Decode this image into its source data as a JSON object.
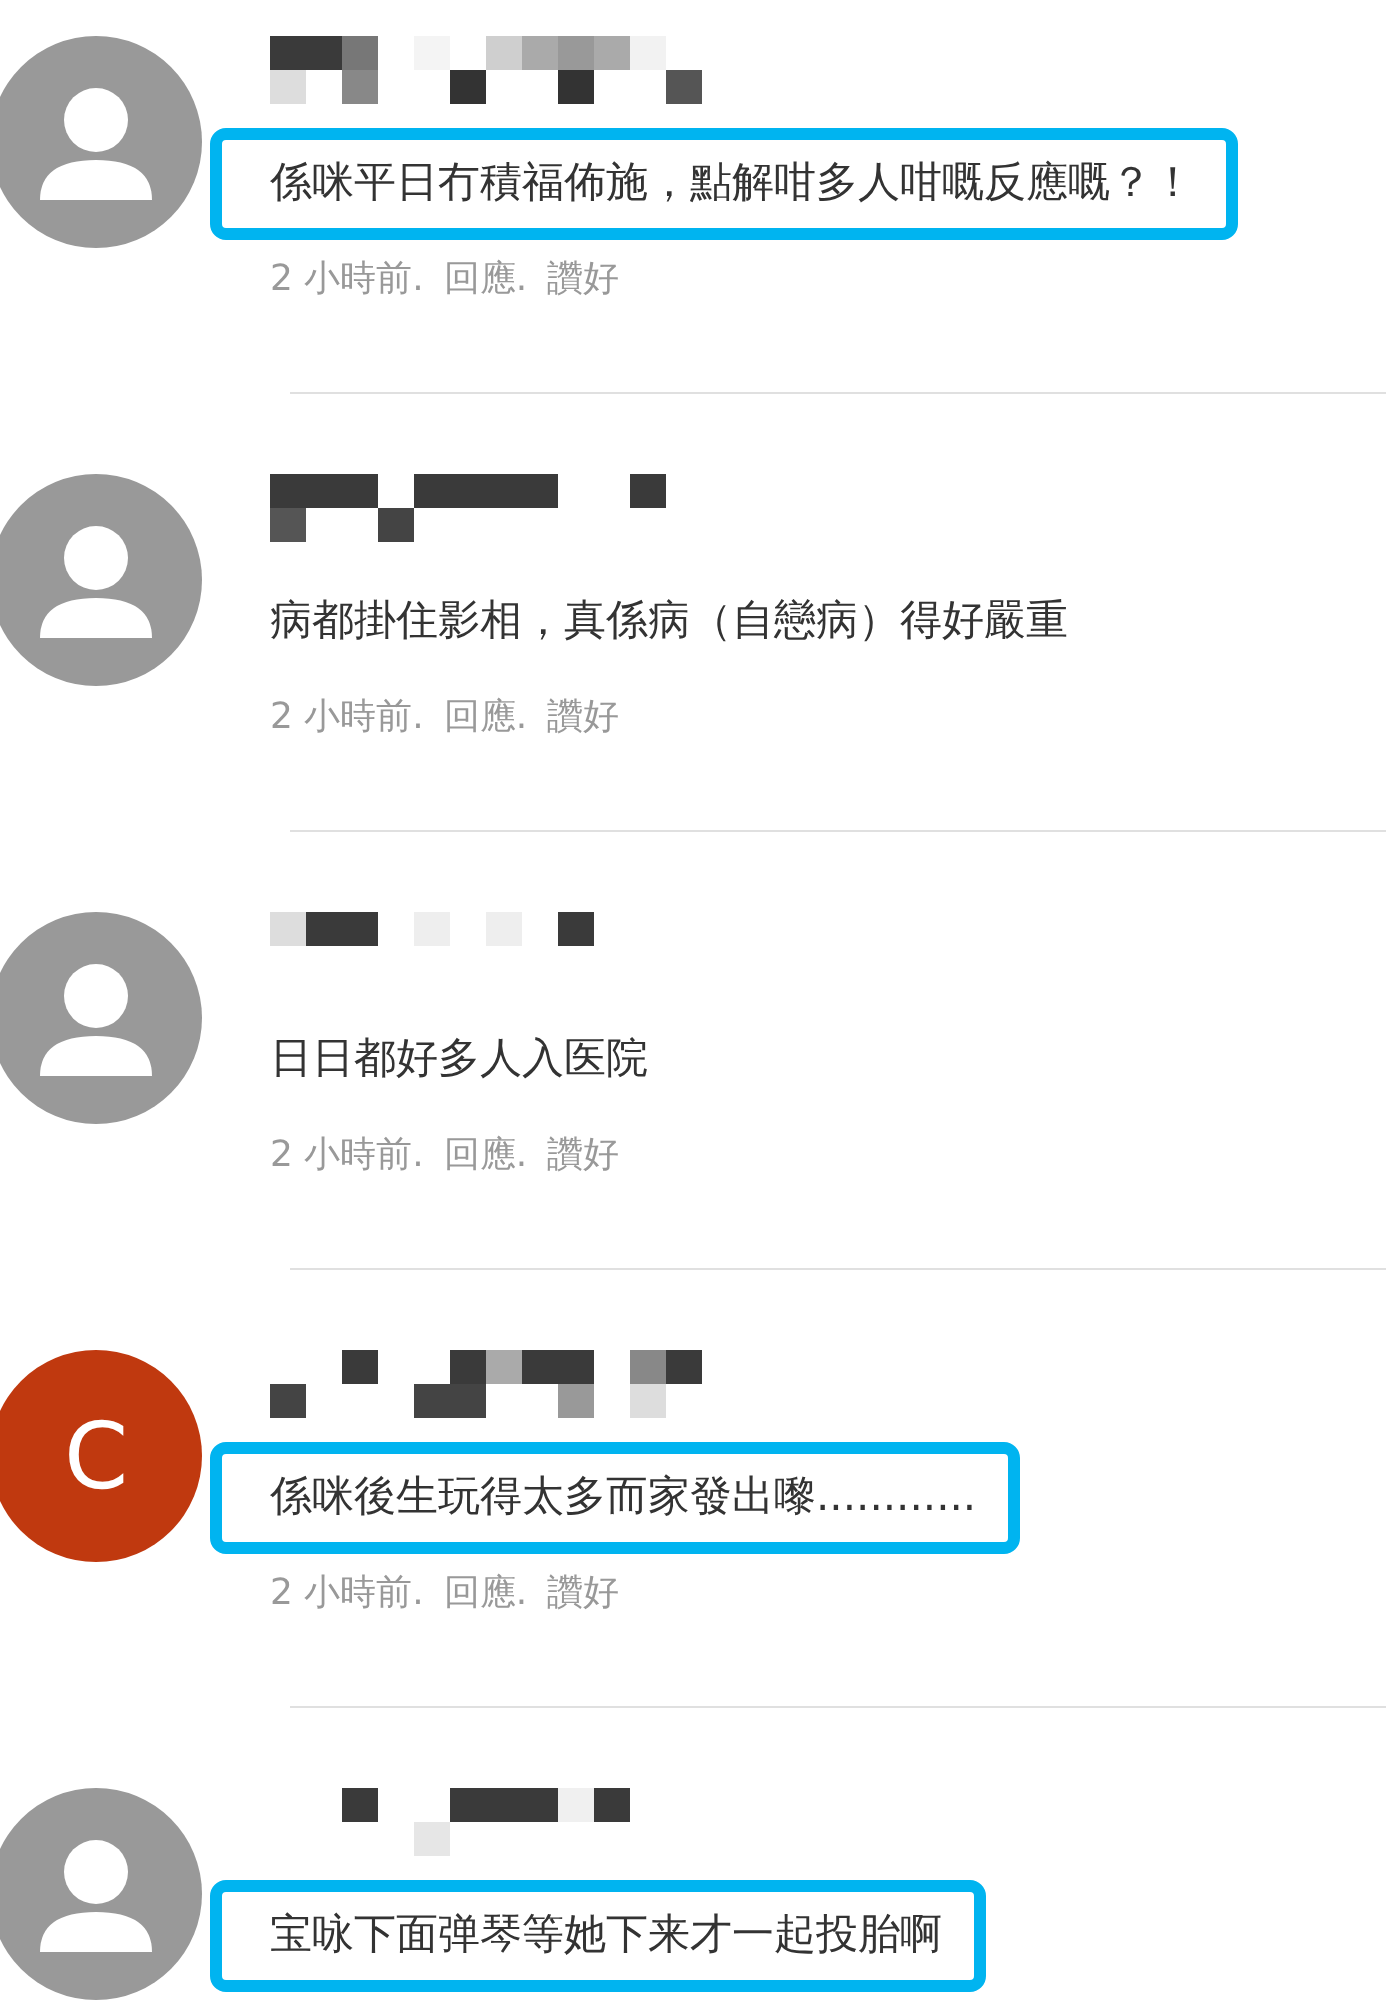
{
  "comments": [
    {
      "avatar": {
        "kind": "generic"
      },
      "text": "係咪平日冇積福佈施，點解咁多人咁嘅反應嘅？！",
      "highlighted": true,
      "meta": [
        "2 小時前.",
        "回應.",
        "讚好"
      ]
    },
    {
      "avatar": {
        "kind": "generic"
      },
      "text": "病都掛住影相，真係病（自戀病）得好嚴重",
      "highlighted": false,
      "meta": [
        "2 小時前.",
        "回應.",
        "讚好"
      ]
    },
    {
      "avatar": {
        "kind": "generic"
      },
      "text": "日日都好多人入医院",
      "highlighted": false,
      "meta": [
        "2 小時前.",
        "回應.",
        "讚好"
      ]
    },
    {
      "avatar": {
        "kind": "letter",
        "letter": "C",
        "color": "#c0390f"
      },
      "text": "係咪後生玩得太多而家發出嚟............",
      "highlighted": true,
      "meta": [
        "2 小時前.",
        "回應.",
        "讚好"
      ]
    },
    {
      "avatar": {
        "kind": "generic"
      },
      "text": "宝咏下面弹琴等她下来才一起投胎啊",
      "highlighted": true
    }
  ]
}
